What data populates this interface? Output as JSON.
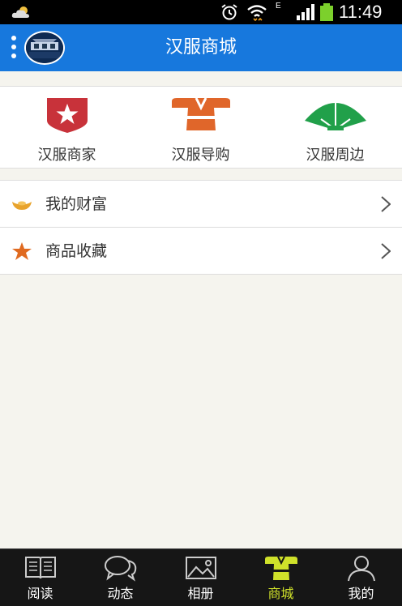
{
  "status_bar": {
    "time": "11:49",
    "network_type": "E",
    "icons": [
      "weather-cloud-icon",
      "alarm-icon",
      "wifi-icon",
      "signal-icon",
      "battery-icon"
    ]
  },
  "header": {
    "title": "汉服商城",
    "menu_icon": "more-vertical-icon",
    "avatar": "user-avatar"
  },
  "categories": [
    {
      "label": "汉服商家",
      "icon": "merchant-badge-icon",
      "color": "#c8323a"
    },
    {
      "label": "汉服导购",
      "icon": "hanfu-robe-icon",
      "color": "#e0662a"
    },
    {
      "label": "汉服周边",
      "icon": "folding-fan-icon",
      "color": "#21a04a"
    }
  ],
  "list": [
    {
      "label": "我的财富",
      "icon": "gold-ingot-icon",
      "color": "#e8a32c"
    },
    {
      "label": "商品收藏",
      "icon": "star-icon",
      "color": "#e06a20"
    }
  ],
  "bottom_nav": {
    "active_index": 3,
    "active_color": "#cfe12a",
    "items": [
      {
        "label": "阅读",
        "icon": "book-icon"
      },
      {
        "label": "动态",
        "icon": "chat-bubbles-icon"
      },
      {
        "label": "相册",
        "icon": "photo-album-icon"
      },
      {
        "label": "商城",
        "icon": "hanfu-robe-icon"
      },
      {
        "label": "我的",
        "icon": "person-icon"
      }
    ]
  }
}
